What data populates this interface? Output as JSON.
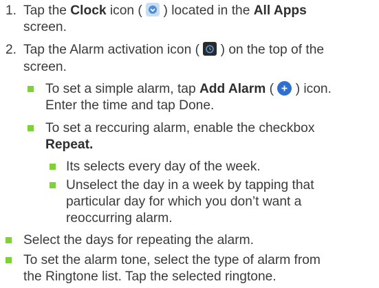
{
  "steps": [
    {
      "number": "1.",
      "pre": "Tap the ",
      "bold1": "Clock",
      "mid": " icon (",
      "post": ") located in the ",
      "bold2": "All Apps",
      "line2": "screen.",
      "icon": "clock-app-icon"
    },
    {
      "number": "2.",
      "pre": "Tap the Alarm activation icon (",
      "post": ") on the top of the",
      "line2": "screen.",
      "icon": "alarm-clock-icon"
    }
  ],
  "sub_bullets": [
    {
      "line1_pre": "To set a simple alarm, tap ",
      "line1_bold": "Add Alarm",
      "line1_mid": " (",
      "line1_post": ") icon.",
      "line2": "Enter the time and tap Done.",
      "icon": "add-plus-icon"
    },
    {
      "line1": "To set a reccuring alarm, enable the checkbox",
      "line2_bold": "Repeat."
    }
  ],
  "sub_sub_bullets": [
    {
      "lines": [
        "Its selects every day of the week."
      ]
    },
    {
      "lines": [
        "Unselect the day in a week by tapping that",
        "particular day for which you don’t want a",
        "reoccurring alarm."
      ]
    }
  ],
  "bottom_bullets": [
    {
      "lines": [
        "Select the days for repeating the alarm."
      ]
    },
    {
      "lines": [
        "To set the alarm tone, select the type of alarm from",
        "the Ringtone list. Tap the selected ringtone."
      ]
    }
  ],
  "colors": {
    "bullet": "#7fd13b",
    "text": "#3a3a3a",
    "clock_icon_bg": "#c8ddf0",
    "alarm_icon_bg": "#2a2a2a",
    "add_icon_bg": "#2f6fd0"
  }
}
